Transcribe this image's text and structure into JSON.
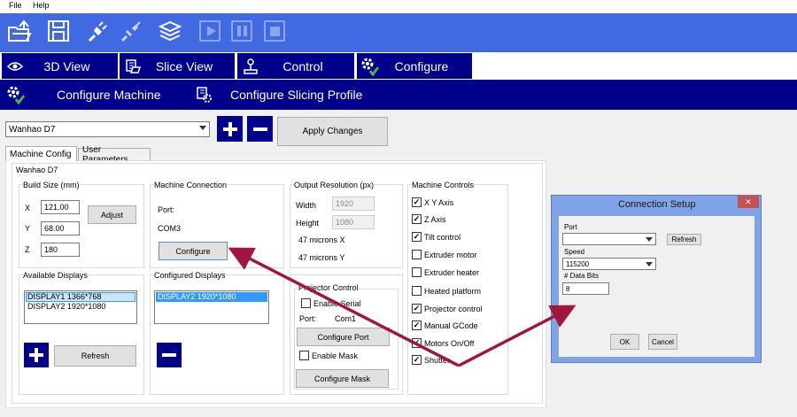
{
  "menu": {
    "file": "File",
    "help": "Help"
  },
  "toolbar": {
    "icons": [
      "open-folder-icon",
      "save-icon",
      "connect-icon",
      "disconnect-icon",
      "slice-icon",
      "play-icon",
      "pause-icon",
      "stop-icon"
    ]
  },
  "main_tabs": [
    {
      "label": "3D View",
      "icon": "eye-icon"
    },
    {
      "label": "Slice View",
      "icon": "layers-icon"
    },
    {
      "label": "Control",
      "icon": "joystick-icon"
    },
    {
      "label": "Configure",
      "icon": "gears-icon"
    }
  ],
  "sub_tabs": {
    "configure_machine": "Configure Machine",
    "configure_slicing_profile": "Configure Slicing Profile"
  },
  "machine_select": {
    "value": "Wanhao D7"
  },
  "apply_changes": "Apply Changes",
  "config_tabs": {
    "machine_config": "Machine Config",
    "user_parameters": "User Parameters"
  },
  "machine_name": "Wanhao D7",
  "build_size": {
    "title": "Build Size (mm)",
    "x_label": "X",
    "x_value": "121.00",
    "y_label": "Y",
    "y_value": "68.00",
    "z_label": "Z",
    "z_value": "180",
    "adjust": "Adjust"
  },
  "machine_connection": {
    "title": "Machine Connection",
    "port_label": "Port:",
    "port_value": "COM3",
    "configure": "Configure"
  },
  "output_resolution": {
    "title": "Output Resolution (px)",
    "width_label": "Width",
    "width_value": "1920",
    "height_label": "Height",
    "height_value": "1080",
    "microns_x": "47 microns X",
    "microns_y": "47 microns Y"
  },
  "machine_controls": {
    "title": "Machine Controls",
    "items": [
      {
        "label": "X Y Axis",
        "checked": true
      },
      {
        "label": "Z Axis",
        "checked": true
      },
      {
        "label": "Tilt control",
        "checked": true
      },
      {
        "label": "Extruder motor",
        "checked": false
      },
      {
        "label": "Extruder heater",
        "checked": false
      },
      {
        "label": "Heated platform",
        "checked": false
      },
      {
        "label": "Projector control",
        "checked": true
      },
      {
        "label": "Manual GCode",
        "checked": true
      },
      {
        "label": "Motors On/Off",
        "checked": true
      },
      {
        "label": "Shutter",
        "checked": true
      }
    ]
  },
  "available_displays": {
    "title": "Available Displays",
    "items": [
      "DISPLAY1 1366*768",
      "DISPLAY2 1920*1080"
    ],
    "refresh": "Refresh"
  },
  "configured_displays": {
    "title": "Configured Displays",
    "items": [
      "DISPLAY2 1920*1080"
    ]
  },
  "projector_control": {
    "title": "Projector Control",
    "enable_serial": "Enable Serial",
    "port_label": "Port:",
    "port_value": "Com1",
    "configure_port": "Configure Port",
    "enable_mask": "Enable Mask",
    "configure_mask": "Configure Mask"
  },
  "connection_setup": {
    "title": "Connection Setup",
    "port_label": "Port",
    "port_value": "",
    "refresh": "Refresh",
    "speed_label": "Speed",
    "speed_value": "115200",
    "data_bits_label": "# Data Bits",
    "data_bits_value": "8",
    "ok": "OK",
    "cancel": "Cancel",
    "close": "✕"
  },
  "colors": {
    "toolbar_blue": "#4169e1",
    "tab_navy": "#00008b",
    "arrow": "#a0163f",
    "close_red": "#c75050"
  }
}
